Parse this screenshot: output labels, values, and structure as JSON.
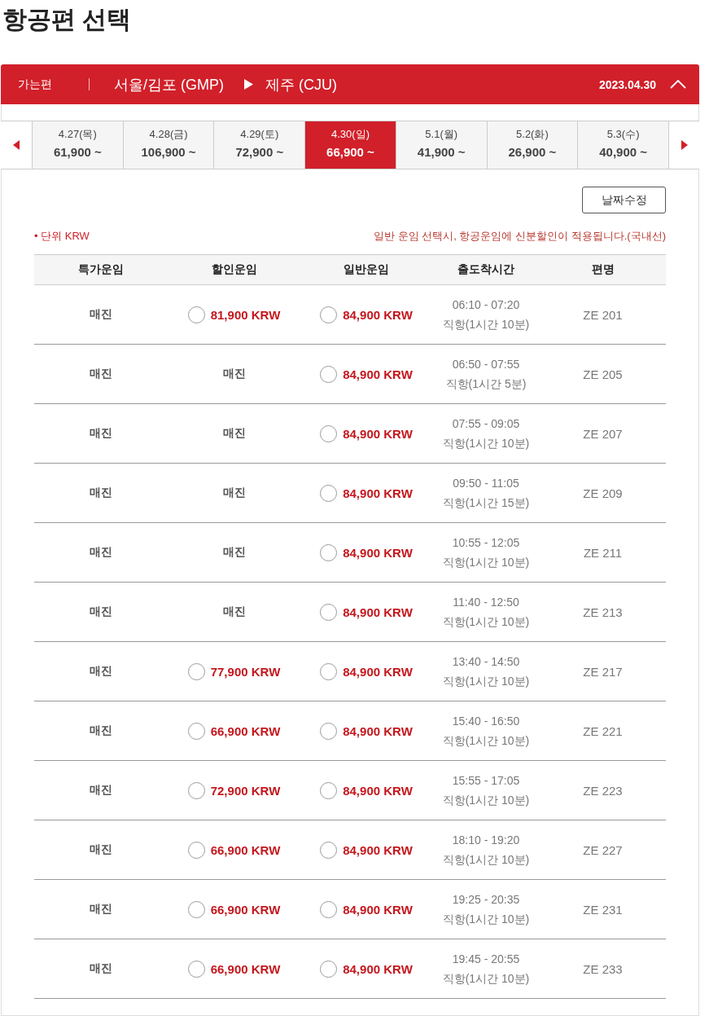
{
  "page_title": "항공편 선택",
  "journey": {
    "label": "가는편",
    "origin": "서울/김포 (GMP)",
    "destination": "제주 (CJU)",
    "date": "2023.04.30",
    "expanded": true
  },
  "date_tabs": [
    {
      "date": "4.27(목)",
      "price": "61,900 ~",
      "selected": false
    },
    {
      "date": "4.28(금)",
      "price": "106,900 ~",
      "selected": false
    },
    {
      "date": "4.29(토)",
      "price": "72,900 ~",
      "selected": false
    },
    {
      "date": "4.30(일)",
      "price": "66,900 ~",
      "selected": true
    },
    {
      "date": "5.1(월)",
      "price": "41,900 ~",
      "selected": false
    },
    {
      "date": "5.2(화)",
      "price": "26,900 ~",
      "selected": false
    },
    {
      "date": "5.3(수)",
      "price": "40,900 ~",
      "selected": false
    }
  ],
  "edit_button": "날짜수정",
  "unit_note": "• 단위 KRW",
  "discount_note": "일반 운임 선택시, 항공운임에 신분할인이 적용됩니다.(국내선)",
  "table": {
    "columns": [
      "특가운임",
      "할인운임",
      "일반운임",
      "출도착시간",
      "편명"
    ],
    "rows": [
      {
        "special_fare": {
          "kind": "soldout",
          "text": "매진"
        },
        "discount_fare": {
          "kind": "radio",
          "text": "81,900 KRW",
          "selected": false
        },
        "normal_fare": {
          "kind": "radio",
          "text": "84,900 KRW",
          "selected": false
        },
        "time": "06:10 - 07:20",
        "duration": "직항(1시간 10분)",
        "flight": "ZE 201"
      },
      {
        "special_fare": {
          "kind": "soldout",
          "text": "매진"
        },
        "discount_fare": {
          "kind": "soldout",
          "text": "매진"
        },
        "normal_fare": {
          "kind": "radio",
          "text": "84,900 KRW",
          "selected": false
        },
        "time": "06:50 - 07:55",
        "duration": "직항(1시간 5분)",
        "flight": "ZE 205"
      },
      {
        "special_fare": {
          "kind": "soldout",
          "text": "매진"
        },
        "discount_fare": {
          "kind": "soldout",
          "text": "매진"
        },
        "normal_fare": {
          "kind": "radio",
          "text": "84,900 KRW",
          "selected": false
        },
        "time": "07:55 - 09:05",
        "duration": "직항(1시간 10분)",
        "flight": "ZE 207"
      },
      {
        "special_fare": {
          "kind": "soldout",
          "text": "매진"
        },
        "discount_fare": {
          "kind": "soldout",
          "text": "매진"
        },
        "normal_fare": {
          "kind": "radio",
          "text": "84,900 KRW",
          "selected": false
        },
        "time": "09:50 - 11:05",
        "duration": "직항(1시간 15분)",
        "flight": "ZE 209"
      },
      {
        "special_fare": {
          "kind": "soldout",
          "text": "매진"
        },
        "discount_fare": {
          "kind": "soldout",
          "text": "매진"
        },
        "normal_fare": {
          "kind": "radio",
          "text": "84,900 KRW",
          "selected": false
        },
        "time": "10:55 - 12:05",
        "duration": "직항(1시간 10분)",
        "flight": "ZE 211"
      },
      {
        "special_fare": {
          "kind": "soldout",
          "text": "매진"
        },
        "discount_fare": {
          "kind": "soldout",
          "text": "매진"
        },
        "normal_fare": {
          "kind": "radio",
          "text": "84,900 KRW",
          "selected": false
        },
        "time": "11:40 - 12:50",
        "duration": "직항(1시간 10분)",
        "flight": "ZE 213"
      },
      {
        "special_fare": {
          "kind": "soldout",
          "text": "매진"
        },
        "discount_fare": {
          "kind": "radio",
          "text": "77,900 KRW",
          "selected": false
        },
        "normal_fare": {
          "kind": "radio",
          "text": "84,900 KRW",
          "selected": false
        },
        "time": "13:40 - 14:50",
        "duration": "직항(1시간 10분)",
        "flight": "ZE 217"
      },
      {
        "special_fare": {
          "kind": "soldout",
          "text": "매진"
        },
        "discount_fare": {
          "kind": "radio",
          "text": "66,900 KRW",
          "selected": false
        },
        "normal_fare": {
          "kind": "radio",
          "text": "84,900 KRW",
          "selected": false
        },
        "time": "15:40 - 16:50",
        "duration": "직항(1시간 10분)",
        "flight": "ZE 221"
      },
      {
        "special_fare": {
          "kind": "soldout",
          "text": "매진"
        },
        "discount_fare": {
          "kind": "radio",
          "text": "72,900 KRW",
          "selected": false
        },
        "normal_fare": {
          "kind": "radio",
          "text": "84,900 KRW",
          "selected": false
        },
        "time": "15:55 - 17:05",
        "duration": "직항(1시간 10분)",
        "flight": "ZE 223"
      },
      {
        "special_fare": {
          "kind": "soldout",
          "text": "매진"
        },
        "discount_fare": {
          "kind": "radio",
          "text": "66,900 KRW",
          "selected": false
        },
        "normal_fare": {
          "kind": "radio",
          "text": "84,900 KRW",
          "selected": false
        },
        "time": "18:10 - 19:20",
        "duration": "직항(1시간 10분)",
        "flight": "ZE 227"
      },
      {
        "special_fare": {
          "kind": "soldout",
          "text": "매진"
        },
        "discount_fare": {
          "kind": "radio",
          "text": "66,900 KRW",
          "selected": false
        },
        "normal_fare": {
          "kind": "radio",
          "text": "84,900 KRW",
          "selected": false
        },
        "time": "19:25 - 20:35",
        "duration": "직항(1시간 10분)",
        "flight": "ZE 231"
      },
      {
        "special_fare": {
          "kind": "soldout",
          "text": "매진"
        },
        "discount_fare": {
          "kind": "radio",
          "text": "66,900 KRW",
          "selected": false
        },
        "normal_fare": {
          "kind": "radio",
          "text": "84,900 KRW",
          "selected": false
        },
        "time": "19:45 - 20:55",
        "duration": "직항(1시간 10분)",
        "flight": "ZE 233"
      }
    ]
  }
}
